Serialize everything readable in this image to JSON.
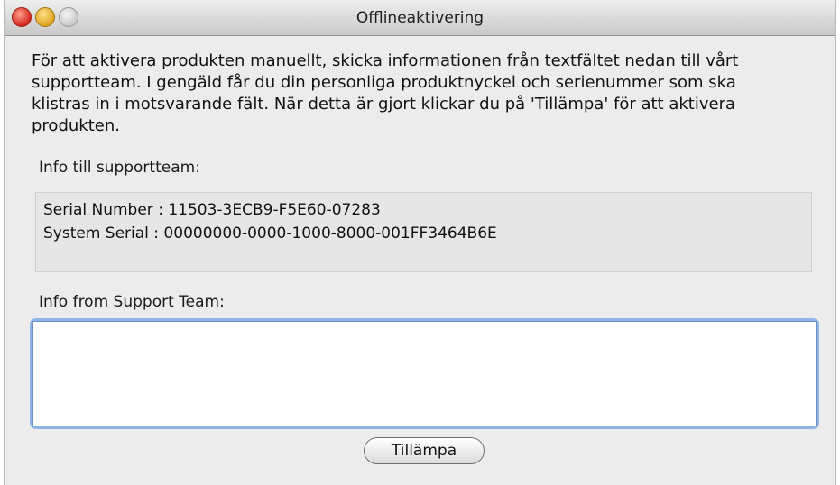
{
  "window": {
    "title": "Offlineaktivering"
  },
  "instructions": "För att aktivera produkten manuellt, skicka informationen från textfältet nedan till vårt supportteam. I gengäld får du din personliga produktnyckel och serienummer som ska klistras in i motsvarande fält. När detta är gjort klickar du på 'Tillämpa' för att aktivera produkten.",
  "info_to_support": {
    "label": "Info till supportteam:",
    "lines": [
      "Serial Number : 11503-3ECB9-F5E60-07283",
      "System Serial : 00000000-0000-1000-8000-001FF3464B6E"
    ]
  },
  "info_from_support": {
    "label": "Info from Support Team:",
    "value": ""
  },
  "buttons": {
    "apply": "Tillämpa"
  }
}
